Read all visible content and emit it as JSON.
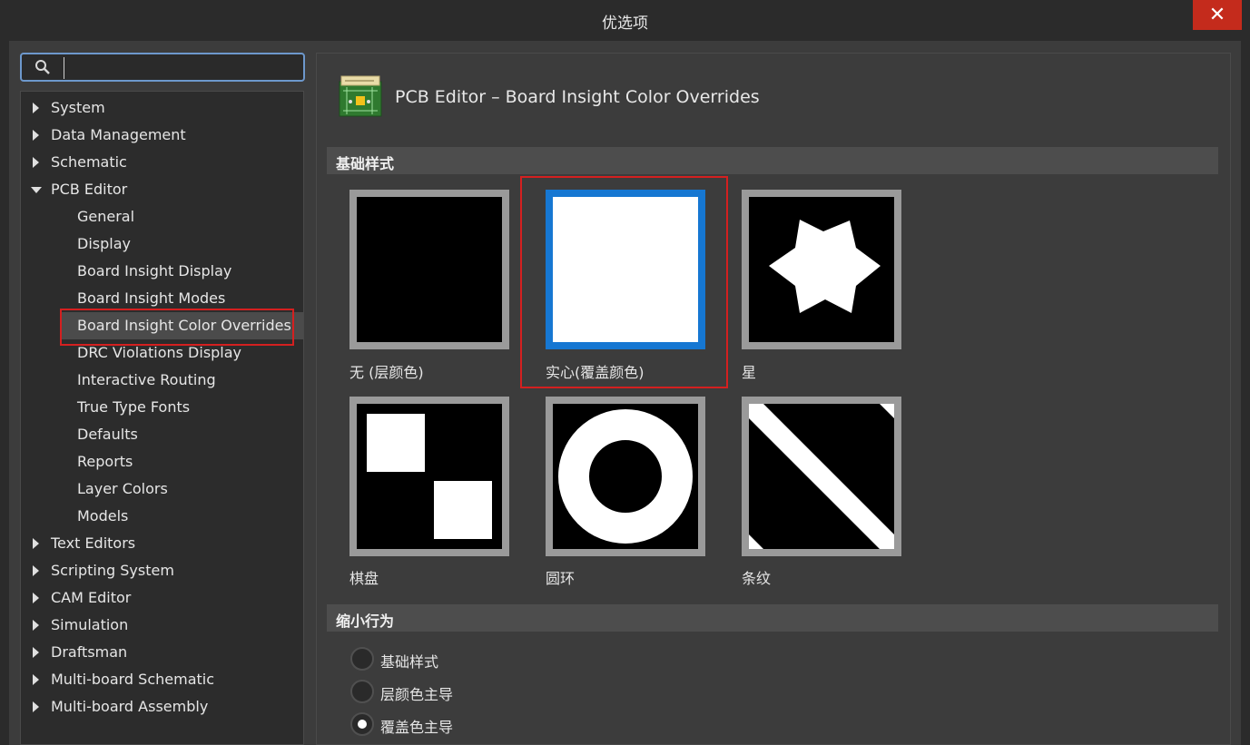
{
  "window": {
    "title": "优选项",
    "close_glyph": "✕"
  },
  "search": {
    "value": "",
    "placeholder": ""
  },
  "tree": {
    "items": [
      {
        "label": "System",
        "expander": "collapsed"
      },
      {
        "label": "Data Management",
        "expander": "collapsed"
      },
      {
        "label": "Schematic",
        "expander": "collapsed"
      },
      {
        "label": "PCB Editor",
        "expander": "expanded"
      },
      {
        "label": "General"
      },
      {
        "label": "Display"
      },
      {
        "label": "Board Insight Display"
      },
      {
        "label": "Board Insight Modes"
      },
      {
        "label": "Board Insight Color Overrides",
        "selected": true
      },
      {
        "label": "DRC Violations Display"
      },
      {
        "label": "Interactive Routing"
      },
      {
        "label": "True Type Fonts"
      },
      {
        "label": "Defaults"
      },
      {
        "label": "Reports"
      },
      {
        "label": "Layer Colors"
      },
      {
        "label": "Models"
      },
      {
        "label": "Text Editors",
        "expander": "collapsed"
      },
      {
        "label": "Scripting System",
        "expander": "collapsed"
      },
      {
        "label": "CAM Editor",
        "expander": "collapsed"
      },
      {
        "label": "Simulation",
        "expander": "collapsed"
      },
      {
        "label": "Draftsman",
        "expander": "collapsed"
      },
      {
        "label": "Multi-board Schematic",
        "expander": "collapsed"
      },
      {
        "label": "Multi-board Assembly",
        "expander": "collapsed"
      }
    ]
  },
  "page": {
    "title": "PCB Editor – Board Insight Color Overrides",
    "icon": "pcb-board-icon",
    "base_style": {
      "heading": "基础样式",
      "options": [
        {
          "label": "无 (层颜色)",
          "pattern": "none"
        },
        {
          "label": "实心(覆盖颜色)",
          "pattern": "solid",
          "selected": true
        },
        {
          "label": "星",
          "pattern": "star"
        },
        {
          "label": "棋盘",
          "pattern": "checkerboard"
        },
        {
          "label": "圆环",
          "pattern": "ring"
        },
        {
          "label": "条纹",
          "pattern": "stripe"
        }
      ]
    },
    "zoom_behavior": {
      "heading": "缩小行为",
      "options": [
        {
          "label": "基础样式",
          "checked": false
        },
        {
          "label": "层颜色主导",
          "checked": false
        },
        {
          "label": "覆盖色主导",
          "checked": true
        }
      ]
    }
  },
  "colors": {
    "highlight_red": "#d42020",
    "selected_blue": "#1677d2",
    "tile_border": "#9a9a9a"
  }
}
